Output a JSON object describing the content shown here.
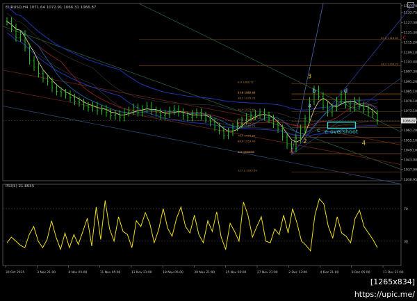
{
  "window": {
    "header": "EURUSD,H4  1071.64 1072.91 1066.31 1066.87",
    "watermark": "[1265x834] https://upic.me/"
  },
  "indicator": {
    "label": "RSI(5) 21.8655"
  },
  "chart_data": [
    {
      "type": "line",
      "name": "price",
      "yaxis_ticks": [
        "1137.70",
        "1133.75",
        "1127.38",
        "1121.30",
        "1115.20",
        "1109.10",
        "1103.40",
        "1097.30",
        "1091.20",
        "1085.10",
        "1079.10",
        "1073.10",
        "1067.30",
        "1061.20",
        "1055.10",
        "1049.10",
        "1043.00",
        "1037.00",
        "1030.95"
      ],
      "ylim": [
        1030.0,
        1139.0
      ],
      "xaxis_ticks": [
        "30 Oct 2015",
        "3 Nov 21:00",
        "6 Nov 05:00",
        "11 Nov 05:00",
        "13 Nov 21:00",
        "18 Nov 05:00",
        "20 Nov 21:00",
        "25 Nov 05:00",
        "27 Nov 21:00",
        "2 Dec 13:00",
        "4 Dec 21:00",
        "9 Dec 05:00",
        "11 Dec 21:00"
      ],
      "last_price_label": "1066.87",
      "fib_levels": [
        {
          "label": "50.0 1116.85",
          "value": 1116.85
        },
        {
          "label": "38.2 1100.73",
          "value": 1100.73
        },
        {
          "label": "0.0 1089.72",
          "value": 1089.72
        },
        {
          "label": "23.6 1083.48",
          "value": 1083.48
        },
        {
          "label": "23.6 1082.91",
          "value": 1082.91
        },
        {
          "label": "38.2 1079.73",
          "value": 1079.73
        },
        {
          "label": "50.0 1072.64",
          "value": 1072.64
        },
        {
          "label": "50.0 1066.68",
          "value": 1066.68
        },
        {
          "label": "61.8 1064.20",
          "value": 1064.2
        },
        {
          "label": "61.8 1062.71",
          "value": 1062.71
        },
        {
          "label": "76.4 1056.64",
          "value": 1056.64
        },
        {
          "label": "88.6 1053.40",
          "value": 1053.4
        },
        {
          "label": "100 1046.63",
          "value": 1046.63
        },
        {
          "label": "0.0 1046.63",
          "value": 1046.63
        },
        {
          "label": "127.2 1035.39",
          "value": 1035.39
        }
      ],
      "close": [
        1128,
        1124,
        1118,
        1120,
        1112,
        1104,
        1100,
        1096,
        1093,
        1091,
        1087,
        1085,
        1084,
        1083,
        1081,
        1079,
        1078,
        1076,
        1075,
        1076,
        1073,
        1074,
        1072,
        1070,
        1071,
        1069,
        1072,
        1073,
        1075,
        1072,
        1074,
        1076,
        1073,
        1072,
        1070,
        1071,
        1073,
        1074,
        1072,
        1070,
        1069,
        1071,
        1072,
        1070,
        1068,
        1066,
        1063,
        1061,
        1058,
        1060,
        1063,
        1065,
        1067,
        1069,
        1070,
        1071,
        1072,
        1070,
        1068,
        1065,
        1062,
        1057,
        1052,
        1050,
        1056,
        1062,
        1068,
        1079,
        1086,
        1082,
        1076,
        1072,
        1075,
        1079,
        1083,
        1077,
        1075,
        1079,
        1076,
        1074,
        1072,
        1071,
        1067
      ],
      "wave_labels": [
        {
          "text": "3",
          "color": "#e0c040",
          "i": 67,
          "y": 1093
        },
        {
          "text": "b",
          "color": "#a0c0ff",
          "i": 68,
          "y": 1084
        },
        {
          "text": "d",
          "color": "#a0c0ff",
          "i": 75,
          "y": 1084
        },
        {
          "text": "a",
          "color": "#a0c0ff",
          "i": 67,
          "y": 1075
        },
        {
          "text": "c",
          "color": "#40d0d0",
          "i": 69,
          "y": 1060
        },
        {
          "text": "e-overshoot",
          "color": "#40d0d0",
          "i": 74,
          "y": 1059
        },
        {
          "text": "2",
          "color": "#e0c040",
          "i": 66,
          "y": 1053
        },
        {
          "text": "4",
          "color": "#e0c040",
          "i": 79,
          "y": 1052
        },
        {
          "text": "c",
          "color": "#d02020",
          "i": 88,
          "y": 1117
        },
        {
          "text": "a",
          "color": "#d02020",
          "i": 63,
          "y": 1047
        }
      ]
    },
    {
      "type": "line",
      "name": "rsi",
      "ylim": [
        0,
        100
      ],
      "yaxis_ticks": [
        "70",
        "30"
      ],
      "values": [
        28,
        35,
        30,
        25,
        22,
        38,
        48,
        30,
        22,
        32,
        55,
        35,
        20,
        40,
        22,
        38,
        26,
        42,
        58,
        24,
        72,
        32,
        80,
        45,
        30,
        60,
        42,
        38,
        22,
        55,
        48,
        65,
        52,
        28,
        44,
        70,
        46,
        36,
        58,
        72,
        48,
        40,
        62,
        38,
        28,
        55,
        42,
        66,
        35,
        20,
        52,
        42,
        30,
        78,
        62,
        35,
        48,
        60,
        30,
        28,
        45,
        38,
        62,
        40,
        70,
        52,
        30,
        25,
        18,
        62,
        82,
        76,
        48,
        34,
        60,
        40,
        36,
        28,
        58,
        68,
        48,
        40,
        32,
        22
      ]
    }
  ]
}
